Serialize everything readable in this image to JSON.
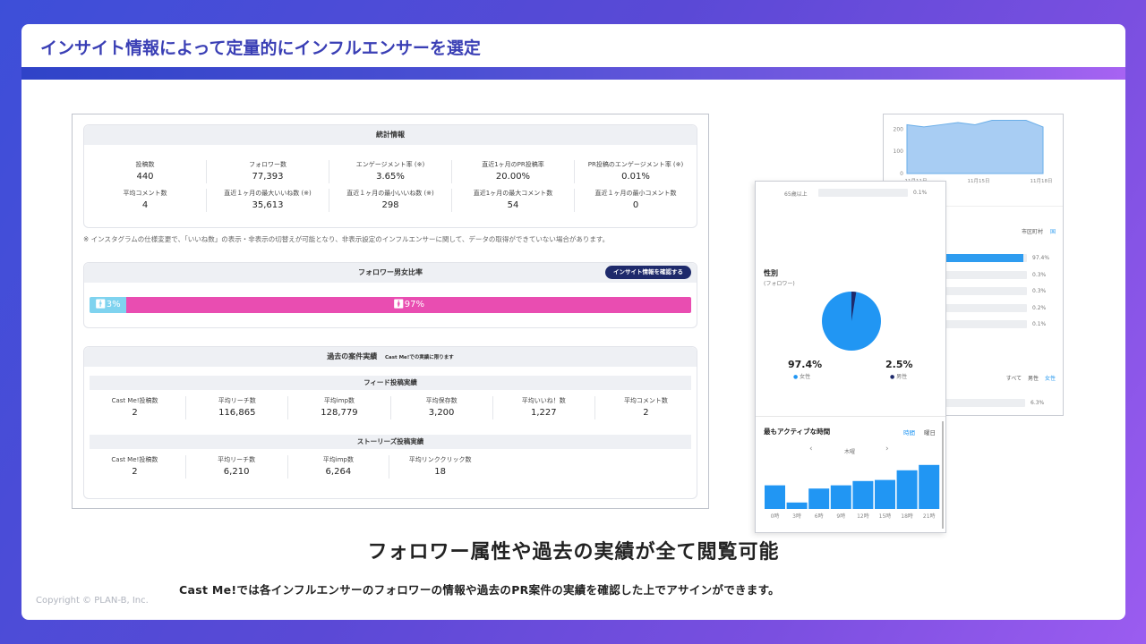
{
  "slide": {
    "title": "インサイト情報によって定量的にインフルエンサーを選定",
    "main_caption": "フォロワー属性や過去の実績が全て閲覧可能",
    "sub_caption": "Cast Me!では各インフルエンサーのフォロワーの情報や過去のPR案件の実績を確認した上でアサインができます。",
    "copyright": "Copyright © PLAN-B, Inc."
  },
  "stats": {
    "title": "統計情報",
    "row1": [
      {
        "label": "投稿数",
        "value": "440"
      },
      {
        "label": "フォロワー数",
        "value": "77,393"
      },
      {
        "label": "エンゲージメント率 (※)",
        "value": "3.65%"
      },
      {
        "label": "直近1ヶ月のPR投稿率",
        "value": "20.00%"
      },
      {
        "label": "PR投稿のエンゲージメント率 (※)",
        "value": "0.01%"
      }
    ],
    "row2": [
      {
        "label": "平均コメント数",
        "value": "4"
      },
      {
        "label": "直近１ヶ月の最大いいね数 (※)",
        "value": "35,613"
      },
      {
        "label": "直近１ヶ月の最小いいね数 (※)",
        "value": "298"
      },
      {
        "label": "直近1ヶ月の最大コメント数",
        "value": "54"
      },
      {
        "label": "直近１ヶ月の最小コメント数",
        "value": "0"
      }
    ],
    "note": "※ インスタグラムの仕様変更で、「いいね数」の表示・非表示の切替えが可能となり、非表示設定のインフルエンサーに関して、データの取得ができていない場合があります。"
  },
  "gender_ratio": {
    "title": "フォロワー男女比率",
    "button": "インサイト情報を確認する",
    "male_label": "3%",
    "female_label": "97%",
    "male_fraction": 0.03
  },
  "past": {
    "title": "過去の案件実績",
    "title_note": "Cast Me!での実績に限ります",
    "feed_title": "フィード投稿実績",
    "feed": [
      {
        "label": "Cast Me!投稿数",
        "value": "2"
      },
      {
        "label": "平均リーチ数",
        "value": "116,865"
      },
      {
        "label": "平均imp数",
        "value": "128,779"
      },
      {
        "label": "平均保存数",
        "value": "3,200"
      },
      {
        "label": "平均いいね！数",
        "value": "1,227"
      },
      {
        "label": "平均コメント数",
        "value": "2"
      }
    ],
    "stories_title": "ストーリーズ投稿実績",
    "stories": [
      {
        "label": "Cast Me!投稿数",
        "value": "2"
      },
      {
        "label": "平均リーチ数",
        "value": "6,210"
      },
      {
        "label": "平均imp数",
        "value": "6,264"
      },
      {
        "label": "平均リンククリック数",
        "value": "18"
      }
    ]
  },
  "area_chart": {
    "y_ticks": [
      "200",
      "100",
      "0"
    ],
    "x_ticks": [
      "11月11日",
      "11月15日",
      "11月18日"
    ],
    "values": [
      220,
      210,
      220,
      230,
      220,
      240,
      240,
      240,
      210
    ],
    "y_max": 250,
    "color": "#a8cdf3"
  },
  "region": {
    "tabs": [
      "市区町村",
      "国"
    ],
    "bars": [
      {
        "label": "97.4%",
        "fraction": 0.974
      },
      {
        "label": "0.3%",
        "fraction": 0.003
      },
      {
        "label": "0.3%",
        "fraction": 0.003
      },
      {
        "label": "0.2%",
        "fraction": 0.002
      },
      {
        "label": "0.1%",
        "fraction": 0.001
      }
    ],
    "filter_tabs": [
      "すべて",
      "男性",
      "女性"
    ],
    "bottom_bar": {
      "label": "6.3%",
      "fraction": 0.063
    }
  },
  "gender_card": {
    "age_label": "65歳以上",
    "age_pct": "0.1%",
    "title": "性別",
    "subtitle": "(フォロワー)",
    "female_pct": "97.4%",
    "female_label": "女性",
    "male_pct": "2.5%",
    "male_label": "男性",
    "female_fraction": 0.974,
    "female_color": "#2196f3",
    "male_color": "#1e2a6b"
  },
  "active_time": {
    "title": "最もアクティブな時間",
    "tab_time": "時間",
    "tab_day": "曜日",
    "day": "木曜",
    "hours": [
      "0時",
      "3時",
      "6時",
      "9時",
      "12時",
      "15時",
      "18時",
      "21時"
    ],
    "values": [
      22,
      6,
      19,
      22,
      26,
      27,
      36,
      41
    ],
    "y_max": 45,
    "color": "#2196f3"
  }
}
